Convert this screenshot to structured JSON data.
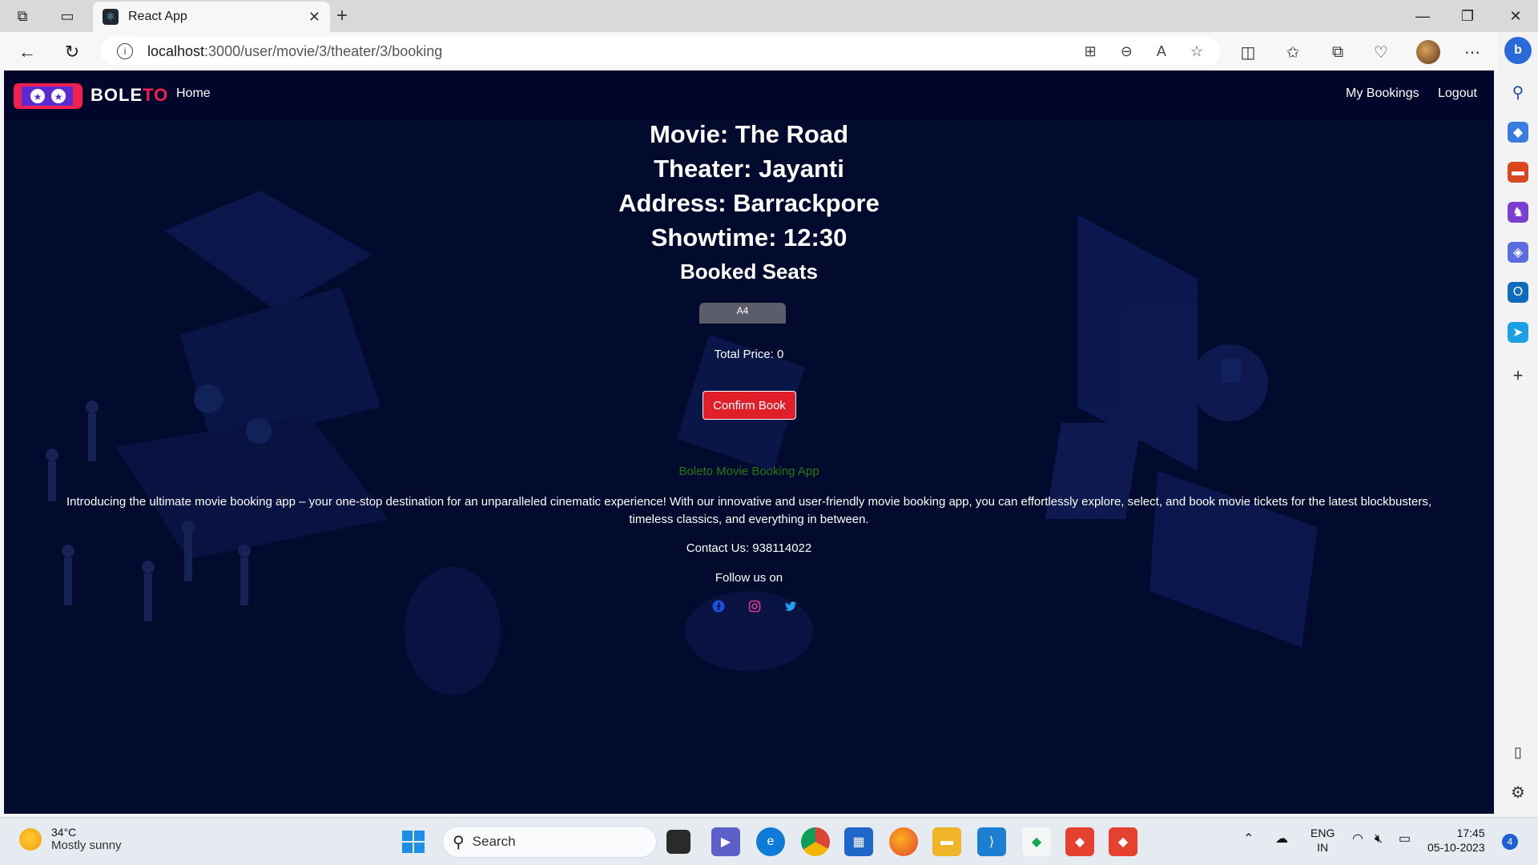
{
  "browser": {
    "tab_title": "React App",
    "url_host": "localhost",
    "url_path": ":3000/user/movie/3/theater/3/booking",
    "close_glyph": "✕",
    "new_tab_glyph": "+"
  },
  "navbar": {
    "brand_main": "BOLE",
    "brand_accent": "TO",
    "home": "Home",
    "my_bookings": "My Bookings",
    "logout": "Logout"
  },
  "booking": {
    "movie": "Movie: The Road",
    "theater": "Theater: Jayanti",
    "address": "Address: Barrackpore",
    "showtime": "Showtime: 12:30",
    "booked_seats_heading": "Booked Seats",
    "seats": [
      "A4"
    ],
    "total_price": "Total Price: 0",
    "confirm_label": "Confirm Book"
  },
  "footer": {
    "title": "Boleto Movie Booking App",
    "description": "Introducing the ultimate movie booking app – your one-stop destination for an unparalleled cinematic experience! With our innovative and user-friendly movie booking app, you can effortlessly explore, select, and book movie tickets for the latest blockbusters, timeless classics, and everything in between.",
    "contact": "Contact Us: 938114022",
    "follow": "Follow us on",
    "social_icons": [
      "facebook-icon",
      "instagram-icon",
      "twitter-icon"
    ]
  },
  "taskbar": {
    "temperature": "34°C",
    "weather": "Mostly sunny",
    "search_label": "Search",
    "lang_1": "ENG",
    "lang_2": "IN",
    "time": "17:45",
    "date": "05-10-2023",
    "notification_count": "4"
  },
  "colors": {
    "page_bg": "#020a2e",
    "navbar_bg": "#01062a",
    "accent_red": "#e01f2a",
    "brand_pink": "#f0214f",
    "footer_title_green": "#1f7a12"
  }
}
